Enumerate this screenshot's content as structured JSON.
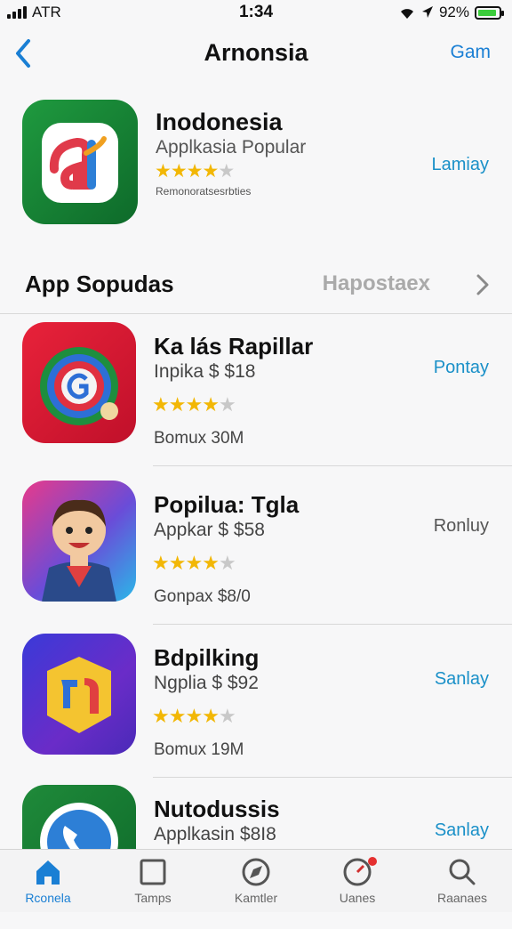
{
  "status_bar": {
    "carrier": "ATR",
    "time": "1:34",
    "battery": "92%",
    "battery_level": 0.92
  },
  "nav": {
    "title": "Arnonsia",
    "right_action": "Gam"
  },
  "featured": {
    "name": "Inodonesia",
    "subtitle": "Applkasia Popular",
    "rating": 4,
    "small_text": "Remonoratsesrbties",
    "action": "Lamiay",
    "icon_colors": {
      "bg": "#1f9a3f",
      "accent": "#e04040"
    }
  },
  "section": {
    "title": "App Sopudas",
    "link": "Hapostaex"
  },
  "apps": [
    {
      "name": "Ka lás Rapillar",
      "price": "Inpika $ $18",
      "rating": 4,
      "size": "Bomux   30M",
      "action": "Pontay",
      "action_style": "blue"
    },
    {
      "name": "Popilua: Tgla",
      "price": "Appkar $ $58",
      "rating": 4,
      "size": "Gonpax   $8/0",
      "action": "Ronluy",
      "action_style": "grey"
    },
    {
      "name": "Bdpilking",
      "price": "Ngplia $ $92",
      "rating": 4,
      "size": "Bomux   19M",
      "action": "Sanlay",
      "action_style": "blue"
    },
    {
      "name": "Nutodussis",
      "price": "Applkasin $8I8",
      "rating": null,
      "size": "",
      "action": "Sanlay",
      "action_style": "blue"
    }
  ],
  "tabs": [
    {
      "label": "Rconela",
      "icon": "home-icon",
      "active": true
    },
    {
      "label": "Tamps",
      "icon": "square-icon",
      "active": false
    },
    {
      "label": "Kamtler",
      "icon": "compass-icon",
      "active": false
    },
    {
      "label": "Uanes",
      "icon": "clock-icon",
      "active": false,
      "badge": true
    },
    {
      "label": "Raanaes",
      "icon": "search-icon",
      "active": false
    }
  ],
  "colors": {
    "accent": "#1a7fd4",
    "star": "#f2b705",
    "star_off": "#c8c8c8"
  }
}
